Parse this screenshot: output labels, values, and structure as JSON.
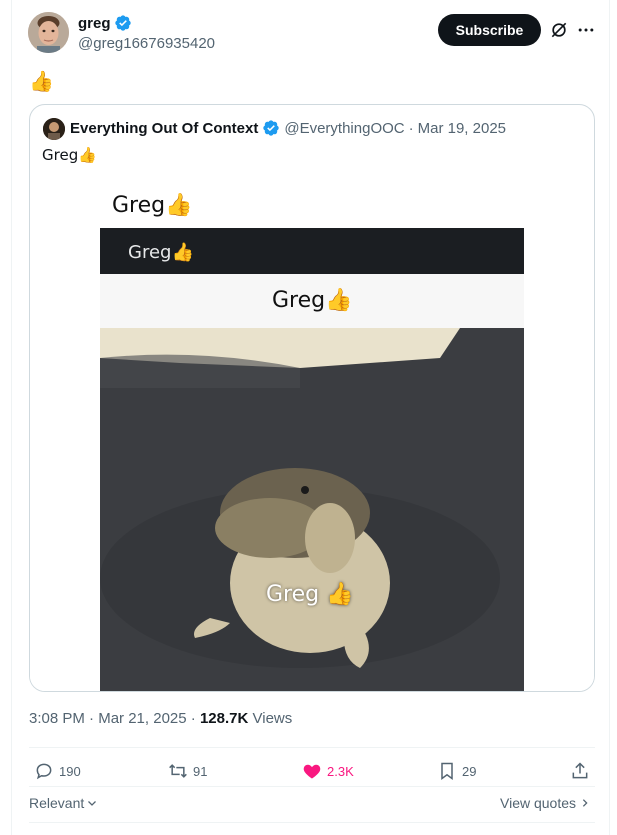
{
  "author": {
    "name": "greg",
    "handle": "@greg16676935420",
    "verified": true
  },
  "actions_top": {
    "subscribe_label": "Subscribe",
    "grok_icon": "grok-icon",
    "more_icon": "more-icon"
  },
  "tweet": {
    "text": "👍"
  },
  "quote": {
    "name": "Everything Out Of Context",
    "handle": "@EverythingOOC",
    "separator": "·",
    "date": "Mar 19, 2025",
    "text": "Greg👍",
    "image": {
      "top_text": "Greg👍",
      "dark_bar_text": "Greg👍",
      "light_bar_text": "Greg👍",
      "photo_text": "Greg 👍"
    }
  },
  "meta": {
    "time": "3:08 PM",
    "separator": "·",
    "date": "Mar 21, 2025",
    "views_count": "128.7K",
    "views_label": "Views"
  },
  "stats": {
    "replies": "190",
    "reposts": "91",
    "likes": "2.3K",
    "bookmarks": "29"
  },
  "footer": {
    "sort_label": "Relevant",
    "view_quotes_label": "View quotes"
  },
  "colors": {
    "verified": "#1d9bf0",
    "like": "#f91880",
    "secondary_text": "#536471"
  }
}
